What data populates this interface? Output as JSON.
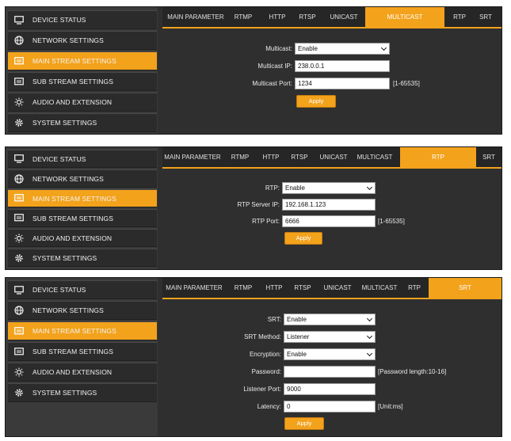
{
  "sidebar_labels": {
    "device_status": "DEVICE STATUS",
    "network_settings": "NETWORK SETTINGS",
    "main_stream_settings": "MAIN STREAM SETTINGS",
    "sub_stream_settings": "SUB STREAM SETTINGS",
    "audio_and_extension": "AUDIO AND EXTENSION",
    "system_settings": "SYSTEM SETTINGS"
  },
  "tab_labels": {
    "main_parameter": "MAIN PARAMETER",
    "rtmp": "RTMP",
    "http": "HTTP",
    "rtsp": "RTSP",
    "unicast": "UNICAST",
    "multicast": "MULTICAST",
    "rtp": "RTP",
    "srt": "SRT"
  },
  "panels": {
    "multicast": {
      "active_tab": "MULTICAST",
      "multicast_label": "Multicast:",
      "multicast_value": "Enable",
      "ip_label": "Multicast IP:",
      "ip_value": "238.0.0.1",
      "port_label": "Multicast Port:",
      "port_value": "1234",
      "port_hint": "[1-65535]",
      "apply_label": "Apply"
    },
    "rtp": {
      "active_tab": "RTP",
      "rtp_label": "RTP:",
      "rtp_value": "Enable",
      "server_ip_label": "RTP Server IP:",
      "server_ip_value": "192.168.1.123",
      "port_label": "RTP Port:",
      "port_value": "6666",
      "port_hint": "[1-65535]",
      "apply_label": "Apply"
    },
    "srt": {
      "active_tab": "SRT",
      "srt_label": "SRT:",
      "srt_value": "Enable",
      "method_label": "SRT Method:",
      "method_value": "Listener",
      "encryption_label": "Encryption:",
      "encryption_value": "Enable",
      "password_label": "Password:",
      "password_value": "",
      "password_hint": "[Password length:10-16]",
      "listener_port_label": "Listener Port:",
      "listener_port_value": "9000",
      "latency_label": "Latency:",
      "latency_value": "0",
      "latency_hint": "[Unit:ms]",
      "apply_label": "Apply"
    }
  },
  "icons": {
    "device_status": "monitor-icon",
    "network_settings": "globe-icon",
    "main_stream_settings": "stream-card-icon",
    "sub_stream_settings": "stream-card-icon",
    "audio_and_extension": "sun-gear-icon",
    "system_settings": "gear-icon"
  },
  "colors": {
    "accent": "#f3a21c",
    "panel_bg": "#2f2f2f",
    "sidebar_item_bg": "#2b2b2b"
  }
}
